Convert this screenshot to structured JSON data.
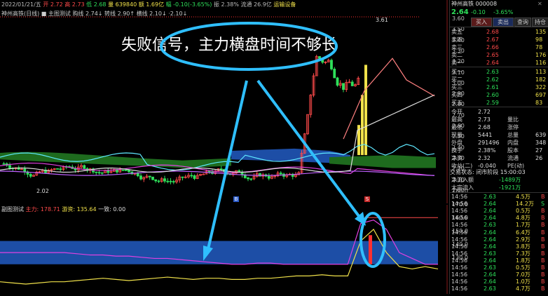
{
  "main_header": {
    "date_label": "2022/01/21/五",
    "open": "开 2.72",
    "high": "高 2.73",
    "low": "低 2.68",
    "volume": "量 639840",
    "amount": "额 1.69亿",
    "change": "幅 -0.10(-3.65%)",
    "change_pct": "振 2.38%",
    "float": "流通 26.9亿",
    "extra": "运输设备",
    "indicator_row": "神州高铁(日线)  ■ 主图测试  购线 2.74↓  转线 2.90↑  横线 2.10↓  ·2.10↓"
  },
  "sub_header": {
    "name": "副图测试",
    "main_force": "主力: 178.71",
    "retail": "游资: 135.64",
    "extra": "一致: 0.00"
  },
  "main_axis": [
    "3.60",
    "3.50",
    "3.40",
    "3.30",
    "3.20",
    "3.10",
    "3.00",
    "2.90",
    "2.80",
    "2.70",
    "2.60",
    "2.50",
    "2.40",
    "2.30",
    "2.20",
    "2.10",
    "2.00"
  ],
  "sub_axis": [
    "180.0",
    "170.0",
    "160.0",
    "150.0",
    "140.0",
    "130.0"
  ],
  "annotation": {
    "text": "失败信号，主力横盘时间不够长",
    "max_label": "3.61",
    "min_label": "2.02"
  },
  "bottom_markers": [
    "B",
    "S"
  ],
  "right_panel": {
    "title": "神州高铁 000008",
    "price": "2.64",
    "change": "-0.10",
    "change_pct": "-3.65%",
    "tabs": [
      "买入",
      "卖出",
      "查询",
      "持仓"
    ],
    "asks": [
      {
        "label": "卖五",
        "price": "2.68",
        "vol": "135"
      },
      {
        "label": "卖四",
        "price": "2.67",
        "vol": "98"
      },
      {
        "label": "卖三",
        "price": "2.66",
        "vol": "78"
      },
      {
        "label": "卖二",
        "price": "2.65",
        "vol": "176"
      },
      {
        "label": "卖一",
        "price": "2.64",
        "vol": "116"
      }
    ],
    "bids": [
      {
        "label": "买一",
        "price": "2.63",
        "vol": "113"
      },
      {
        "label": "买二",
        "price": "2.62",
        "vol": "182"
      },
      {
        "label": "买三",
        "price": "2.61",
        "vol": "322"
      },
      {
        "label": "买四",
        "price": "2.60",
        "vol": "697"
      },
      {
        "label": "买五",
        "price": "2.59",
        "vol": "83"
      }
    ],
    "stats": [
      {
        "l1": "今开",
        "v1": "2.72",
        "l2": "",
        "v2": ""
      },
      {
        "l1": "最高",
        "v1": "2.73",
        "l2": "量比",
        "v2": ""
      },
      {
        "l1": "最低",
        "v1": "2.68",
        "l2": "涨停",
        "v2": ""
      },
      {
        "l1": "现量",
        "v1": "5441",
        "l2": "总量",
        "v2": "639"
      },
      {
        "l1": "外盘",
        "v1": "291496",
        "l2": "内盘",
        "v2": "348"
      },
      {
        "l1": "换手",
        "v1": "2.38%",
        "l2": "股本",
        "v2": "27"
      },
      {
        "l1": "净资",
        "v1": "2.32",
        "l2": "流通",
        "v2": "26"
      },
      {
        "l1": "收益(二)",
        "v1": "-0.040",
        "l2": "PE(动)",
        "v2": ""
      }
    ],
    "status_label": "交易状态: 闭市阶段 15:00:03",
    "flow": [
      {
        "label": "净流入额",
        "value": "-1489万"
      },
      {
        "label": "大宗流入",
        "value": "-1921万"
      }
    ],
    "ticks": [
      {
        "t": "14:56",
        "p": "2.63",
        "v": "4.5万",
        "s": "B"
      },
      {
        "t": "14:56",
        "p": "2.64",
        "v": "14.2万",
        "s": "S"
      },
      {
        "t": "14:56",
        "p": "2.64",
        "v": "0.5万",
        "s": "B"
      },
      {
        "t": "14:56",
        "p": "2.64",
        "v": "4.8万",
        "s": "B"
      },
      {
        "t": "14:56",
        "p": "2.63",
        "v": "1.7万",
        "s": "B"
      },
      {
        "t": "14:56",
        "p": "2.64",
        "v": "6.4万",
        "s": "B"
      },
      {
        "t": "14:56",
        "p": "2.64",
        "v": "2.9万",
        "s": "B"
      },
      {
        "t": "14:56",
        "p": "2.64",
        "v": "3.8万",
        "s": "B"
      },
      {
        "t": "14:56",
        "p": "2.63",
        "v": "7.3万",
        "s": "B"
      },
      {
        "t": "14:56",
        "p": "2.64",
        "v": "1.8万",
        "s": "B"
      },
      {
        "t": "14:56",
        "p": "2.63",
        "v": "0.5万",
        "s": "B"
      },
      {
        "t": "14:56",
        "p": "2.64",
        "v": "7.0万",
        "s": "B"
      },
      {
        "t": "14:56",
        "p": "2.64",
        "v": "1.0万",
        "s": "B"
      },
      {
        "t": "14:56",
        "p": "2.63",
        "v": "4.7万",
        "s": "B"
      }
    ]
  },
  "colors": {
    "up": "#ff4a4a",
    "down": "#2ee05a",
    "cloud_blue": "#1d4ea6",
    "cloud_green": "#1e6b1e",
    "annotation": "#2fbfff"
  },
  "chart_data": {
    "type": "line",
    "title": "",
    "series": [
      {
        "name": "主力",
        "values": [
          150,
          150,
          150,
          150,
          150,
          150,
          149,
          148,
          148,
          147,
          147,
          146,
          145,
          145,
          144,
          143,
          142,
          141,
          140,
          140,
          141,
          141,
          140,
          140,
          140,
          140,
          140,
          140,
          175,
          178,
          170,
          150,
          145,
          140,
          140
        ]
      },
      {
        "name": "游资",
        "values": [
          125,
          124,
          123,
          124,
          125,
          125,
          126,
          127,
          128,
          127,
          126,
          127,
          128,
          129,
          128,
          127,
          128,
          128,
          127,
          127,
          128,
          128,
          129,
          130,
          130,
          131,
          130,
          130,
          160,
          170,
          150,
          138,
          136,
          138,
          136
        ]
      }
    ],
    "ylim": [
      120,
      185
    ]
  }
}
